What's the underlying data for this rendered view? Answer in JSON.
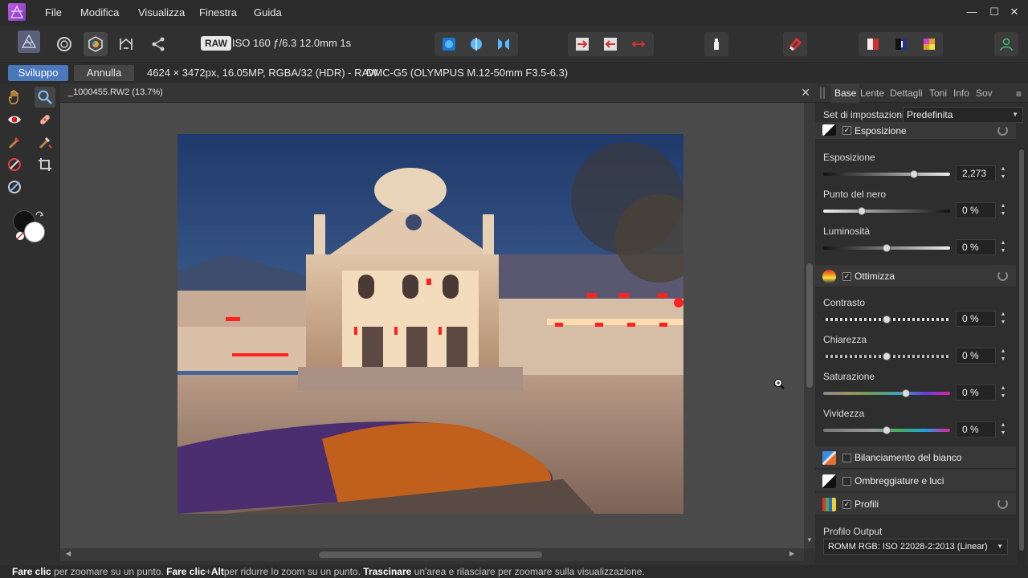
{
  "menu": {
    "items": [
      "File",
      "Modifica",
      "Visualizza",
      "Finestra",
      "Guida"
    ]
  },
  "window_controls": {
    "minimize": "—",
    "maximize": "☐",
    "close": "✕"
  },
  "toolbar": {
    "raw_badge": "RAW",
    "exif": "ISO 160 ƒ/6.3 12.0mm 1s"
  },
  "context_bar": {
    "develop_label": "Sviluppo",
    "cancel_label": "Annulla",
    "image_info": "4624 × 3472px, 16.05MP, RGBA/32 (HDR) - RAW",
    "camera_info": "DMC-G5 (OLYMPUS M.12-50mm F3.5-6.3)"
  },
  "document": {
    "title": "_1000455.RW2 (13.7%)",
    "close": "✕"
  },
  "panel": {
    "tabs": [
      "Base",
      "Lente",
      "Dettagli",
      "Toni",
      "Info",
      "Sov"
    ],
    "active_tab": "Base",
    "preset_label": "Set di impostazioni:",
    "preset_value": "Predefinita",
    "sections": {
      "exposure": {
        "title": "Esposizione",
        "checked": true,
        "props": [
          {
            "label": "Esposizione",
            "value": "2,273",
            "level": 0.72
          },
          {
            "label": "Punto del nero",
            "value": "0 %",
            "level": 0.3
          },
          {
            "label": "Luminosità",
            "value": "0 %",
            "level": 0.5
          }
        ]
      },
      "enhance": {
        "title": "Ottimizza",
        "checked": true,
        "props": [
          {
            "label": "Contrasto",
            "value": "0 %",
            "level": 0.5
          },
          {
            "label": "Chiarezza",
            "value": "0 %",
            "level": 0.5
          },
          {
            "label": "Saturazione",
            "value": "0 %",
            "level": 0.66
          },
          {
            "label": "Vividezza",
            "value": "0 %",
            "level": 0.5
          }
        ]
      },
      "white_balance": {
        "title": "Bilanciamento del bianco",
        "checked": false
      },
      "shadows": {
        "title": "Ombreggiature e luci",
        "checked": false
      },
      "profiles": {
        "title": "Profili",
        "checked": true,
        "output_label": "Profilo Output",
        "output_value": "ROMM RGB: ISO 22028-2:2013 (Linear)"
      }
    }
  },
  "status": {
    "b1": "Fare clic",
    "t1": " per zoomare su un punto. ",
    "b2": "Fare clic",
    "t2": "+",
    "b3": "Alt",
    "t3": "per ridurre lo zoom su un punto. ",
    "b4": "Trascinare",
    "t4": " un'area e rilasciare per zoomare sulla visualizzazione."
  },
  "colors": {
    "accent": "#4b78bb",
    "photo_sky": "#2b4a7a"
  }
}
